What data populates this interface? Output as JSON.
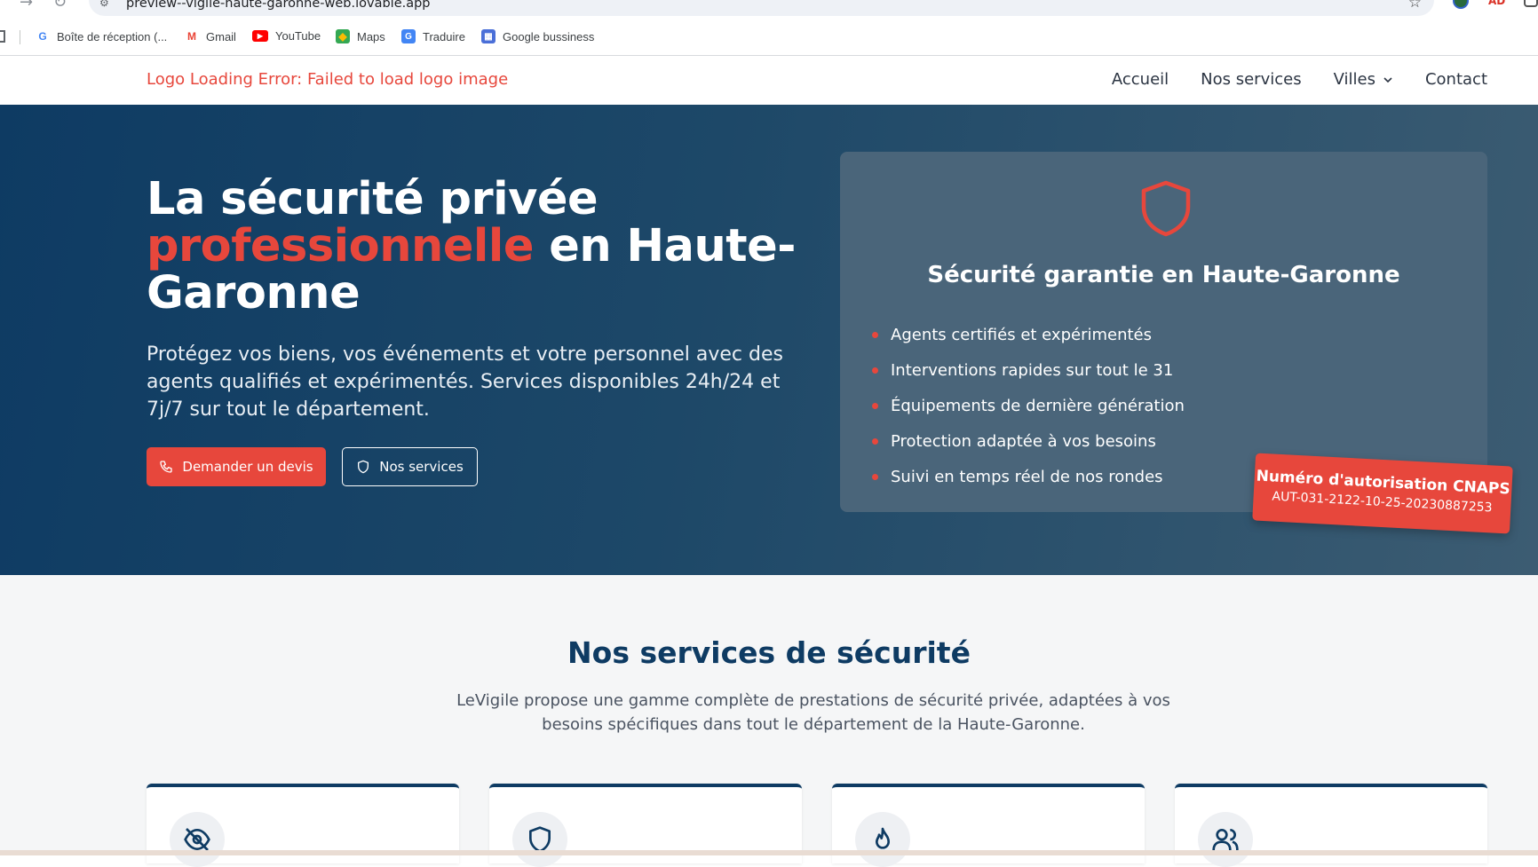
{
  "browser": {
    "url": "preview--vigile-haute-garonne-web.lovable.app",
    "bookmarks": [
      {
        "label": "Boîte de réception (...",
        "icon": "google-icon"
      },
      {
        "label": "Gmail",
        "icon": "gmail-icon"
      },
      {
        "label": "YouTube",
        "icon": "youtube-icon"
      },
      {
        "label": "Maps",
        "icon": "maps-icon"
      },
      {
        "label": "Traduire",
        "icon": "translate-icon"
      },
      {
        "label": "Google bussiness",
        "icon": "business-icon"
      }
    ]
  },
  "header": {
    "logo_error": "Logo Loading Error: Failed to load logo image",
    "nav": {
      "home": "Accueil",
      "services": "Nos services",
      "cities": "Villes",
      "contact": "Contact"
    }
  },
  "hero": {
    "title_line1": "La sécurité privée",
    "title_accent": "professionnelle",
    "title_rest": " en Haute-Garonne",
    "description": "Protégez vos biens, vos événements et votre personnel avec des agents qualifiés et expérimentés. Services disponibles 24h/24 et 7j/7 sur tout le département.",
    "cta_quote": "Demander un devis",
    "cta_services": "Nos services",
    "card": {
      "title": "Sécurité garantie en Haute-Garonne",
      "items": [
        "Agents certifiés et expérimentés",
        "Interventions rapides sur tout le 31",
        "Équipements de dernière génération",
        "Protection adaptée à vos besoins",
        "Suivi en temps réel de nos rondes"
      ]
    },
    "cnaps": {
      "title": "Numéro d'autorisation CNAPS",
      "number": "AUT-031-2122-10-25-20230887253"
    }
  },
  "services_section": {
    "title": "Nos services de sécurité",
    "description": "LeVigile propose une gamme complète de prestations de sécurité privée, adaptées à vos besoins spécifiques dans tout le département de la Haute-Garonne.",
    "cards": [
      {
        "icon": "eye-off-icon"
      },
      {
        "icon": "shield-icon"
      },
      {
        "icon": "flame-icon"
      },
      {
        "icon": "users-icon"
      }
    ]
  },
  "colors": {
    "accent": "#e7473c",
    "navy": "#0e3b63",
    "card_bg": "#4a657a"
  }
}
